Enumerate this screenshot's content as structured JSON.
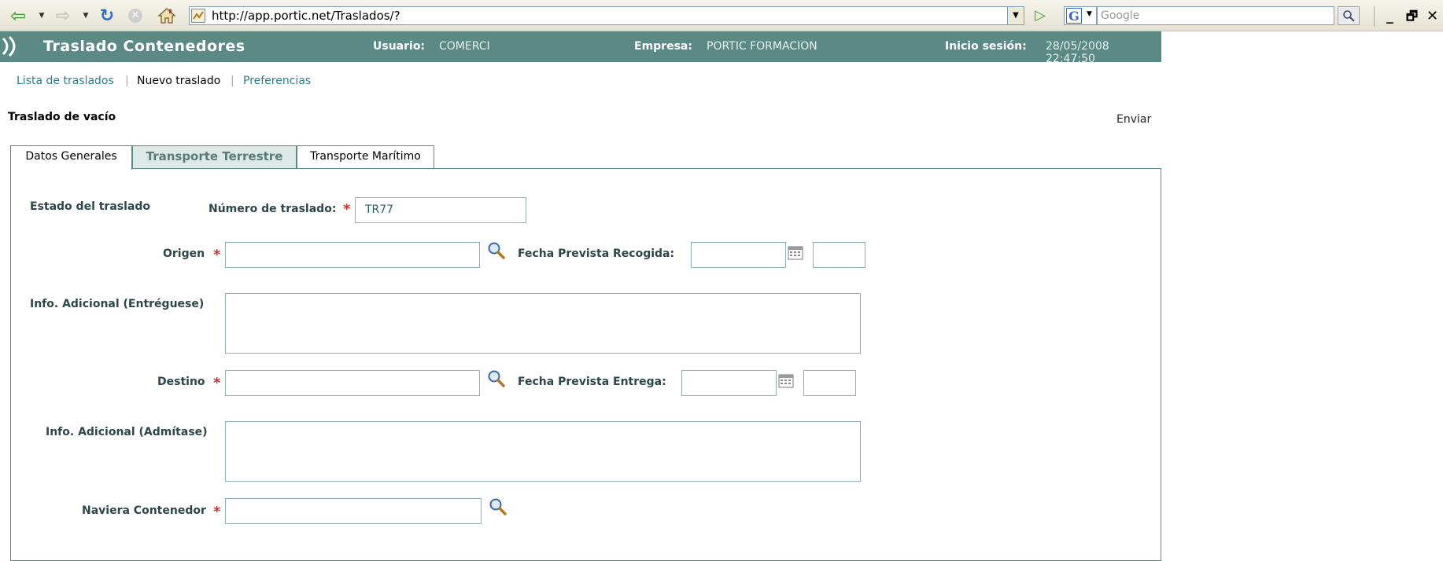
{
  "browser": {
    "url": "http://app.portic.net/Traslados/?",
    "search_placeholder": "Google",
    "window_controls": [
      "_",
      "🗗",
      "✕"
    ]
  },
  "header": {
    "title": "Traslado Contenedores",
    "usuario_label": "Usuario:",
    "usuario_value": "COMERCI",
    "empresa_label": "Empresa:",
    "empresa_value": "PORTIC FORMACION",
    "inicio_label": "Inicio sesión:",
    "inicio_value": "28/05/2008 22:47:50"
  },
  "subnav": {
    "items": [
      "Lista de traslados",
      "Nuevo traslado",
      "Preferencias"
    ],
    "separator": "|"
  },
  "page": {
    "section_title": "Traslado de vacío",
    "enviar": "Enviar"
  },
  "tabs": [
    {
      "label": "Datos Generales",
      "active": true
    },
    {
      "label": "Transporte Terrestre",
      "active": false
    },
    {
      "label": "Transporte Marítimo",
      "active": false
    }
  ],
  "form": {
    "estado_label": "Estado del traslado",
    "numero_label": "Número de traslado:",
    "numero_value": "TR77",
    "required_mark": "*",
    "origen_label": "Origen",
    "origen_value": "",
    "fecha_recogida_label": "Fecha Prevista Recogida:",
    "info_entreguese_label": "Info. Adicional (Entréguese)",
    "destino_label": "Destino",
    "destino_value": "",
    "fecha_entrega_label": "Fecha Prevista Entrega:",
    "info_admitase_label": "Info. Adicional (Admítase)",
    "naviera_label": "Naviera Contenedor",
    "naviera_value": ""
  },
  "colors": {
    "header_bg": "#5b8a84",
    "link": "#2b7d8c",
    "required": "#d23030"
  }
}
